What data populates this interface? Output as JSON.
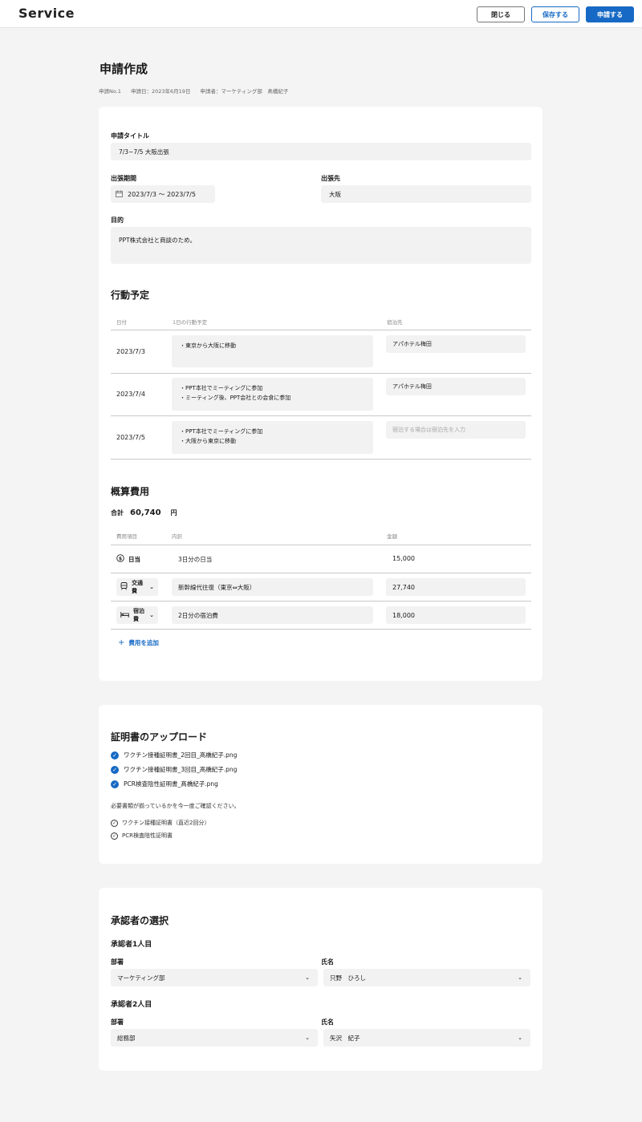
{
  "header": {
    "logo": "Service",
    "close_label": "閉じる",
    "save_label": "保存する",
    "submit_label": "申請する"
  },
  "page": {
    "title": "申請作成",
    "meta": {
      "number": "申請No.1",
      "date": "申請日：2023年6月19日",
      "applicant": "申請者：マーケティング部　髙橋紀子"
    }
  },
  "form": {
    "title_label": "申請タイトル",
    "title_value": "7/3~7/5 大阪出張",
    "period_label": "出張期間",
    "period_value": "2023/7/3 ～ 2023/7/5",
    "destination_label": "出張先",
    "destination_value": "大阪",
    "purpose_label": "目的",
    "purpose_value": "PPT株式会社と商談のため。"
  },
  "schedule": {
    "title": "行動予定",
    "headers": {
      "date": "日付",
      "plan": "1日の行動予定",
      "lodging": "宿泊先"
    },
    "rows": [
      {
        "date": "2023/7/3",
        "plan_1": "・東京から大阪に移動",
        "plan_2": "",
        "lodging": "アパホテル梅田"
      },
      {
        "date": "2023/7/4",
        "plan_1": "・PPT本社でミーティングに参加",
        "plan_2": "・ミーティング後、PPT会社との会食に参加",
        "lodging": "アパホテル梅田"
      },
      {
        "date": "2023/7/5",
        "plan_1": "・PPT本社でミーティングに参加",
        "plan_2": "・大阪から東京に移動",
        "lodging": ""
      }
    ],
    "lodging_placeholder": "宿泊する場合は宿泊先を入力"
  },
  "expenses": {
    "title": "概算費用",
    "total_label": "合計",
    "total_value": "60,740",
    "total_unit": "円",
    "headers": {
      "item": "費用項目",
      "detail": "内訳",
      "amount": "金額"
    },
    "rows": [
      {
        "item": "日当",
        "icon": "coin-icon",
        "detail": "3日分の日当",
        "amount": "15,000"
      },
      {
        "item": "交通費",
        "icon": "train-icon",
        "detail": "新幹線代往復（東京⇔大阪）",
        "amount": "27,740"
      },
      {
        "item": "宿泊費",
        "icon": "bed-icon",
        "detail": "2日分の宿泊費",
        "amount": "18,000"
      }
    ],
    "add_label": "費用を追加"
  },
  "upload": {
    "title": "証明書のアップロード",
    "files": [
      "ワクチン接種証明書_2回目_髙橋紀子.png",
      "ワクチン接種証明書_3回目_髙橋紀子.png",
      "PCR検査陰性証明書_髙橋紀子.png"
    ],
    "note": "必要書類が揃っているかを今一度ご確認ください。",
    "requirements": [
      "ワクチン接種証明書（直近2回分）",
      "PCR検査陰性証明書"
    ]
  },
  "approvers": {
    "title": "承認者の選択",
    "first_label": "承認者1人目",
    "second_label": "承認者2人目",
    "dept_label": "部署",
    "name_label": "氏名",
    "first_dept": "マーケティング部",
    "first_name": "只野　ひろし",
    "second_dept": "総務部",
    "second_name": "矢沢　紀子"
  },
  "colors": {
    "accent": "#1669c4",
    "background": "#f4f4f4",
    "field": "#f2f2f2"
  }
}
